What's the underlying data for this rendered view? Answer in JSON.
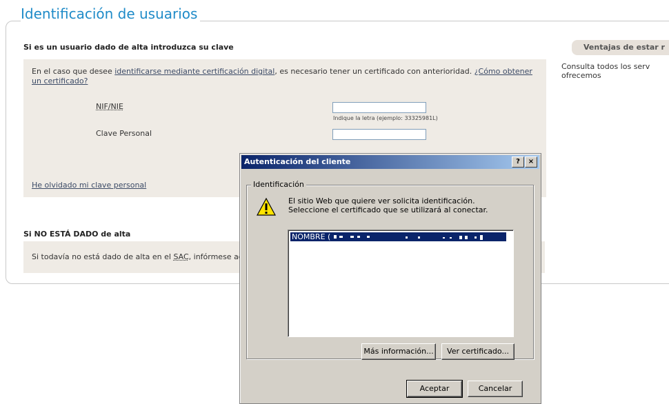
{
  "page": {
    "title": "Identificación de usuarios"
  },
  "login_section": {
    "title": "Si es un usuario dado de alta introduzca su clave",
    "intro_before": "En el caso que desee ",
    "intro_link": "identificarse mediante certificación digital",
    "intro_middle": ", es necesario tener un certificado con anterioridad. ",
    "intro_link2": "¿Cómo obtener un certificado?",
    "nif_label": "NIF/NIE",
    "nif_hint": "Indique la letra (ejemplo: 33325981L)",
    "password_label": "Clave Personal",
    "forgot_link": "He olvidado mi clave personal"
  },
  "register_section": {
    "title": "Si NO ESTÁ DADO de alta",
    "text_before": "Si todavía no está dado de alta en el ",
    "sac": "SAC",
    "text_after": ", infórmese aq"
  },
  "sidebar": {
    "title": "Ventajas de estar r",
    "text": "Consulta todos los serv ofrecemos"
  },
  "dialog": {
    "title": "Autenticación del cliente",
    "help_button": "?",
    "close_button": "×",
    "group_label": "Identificación",
    "message_line1": "El sitio Web que quiere ver solicita identificación.",
    "message_line2": "Seleccione el certificado que se utilizará al conectar.",
    "certificate_item": "NOMBRE (",
    "more_info_button": "Más información...",
    "view_cert_button": "Ver certificado...",
    "ok_button": "Aceptar",
    "cancel_button": "Cancelar",
    "icons": {
      "warning": "warning-icon"
    }
  },
  "colors": {
    "title_blue": "#1f8bc8",
    "beige": "#efebe5",
    "dialog_gray": "#d4d0c8",
    "titlebar_start": "#0a246a",
    "titlebar_end": "#a6caf0"
  }
}
